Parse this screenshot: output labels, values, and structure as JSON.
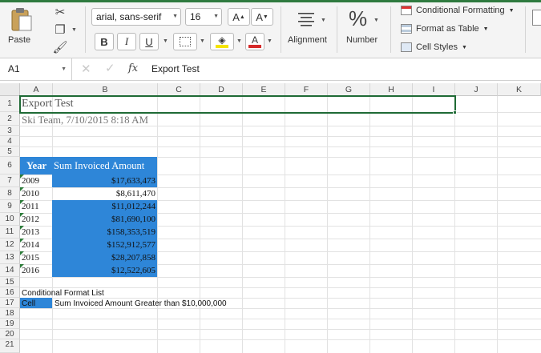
{
  "ribbon": {
    "paste_label": "Paste",
    "font_name": "arial, sans-serif",
    "font_size": "16",
    "increase_font_label": "A",
    "decrease_font_label": "A",
    "bold_label": "B",
    "italic_label": "I",
    "underline_label": "U",
    "font_color_label": "A",
    "alignment_label": "Alignment",
    "number_label": "Number",
    "number_icon": "%",
    "conditional_formatting_label": "Conditional Formatting",
    "format_as_table_label": "Format as Table",
    "cell_styles_label": "Cell Styles",
    "accent_color": "#2f7a3f",
    "fill_color": "#f5e400",
    "font_color": "#d62b2b"
  },
  "formula_bar": {
    "name_box": "A1",
    "fx_label": "fx",
    "content": "Export Test"
  },
  "columns": [
    "A",
    "B",
    "C",
    "D",
    "E",
    "F",
    "G",
    "H",
    "I",
    "J",
    "K"
  ],
  "rows": [
    "1",
    "2",
    "3",
    "4",
    "5",
    "6",
    "7",
    "8",
    "9",
    "10",
    "11",
    "12",
    "13",
    "14",
    "15",
    "16",
    "17",
    "18",
    "19",
    "20",
    "21"
  ],
  "sheet": {
    "title": "Export Test",
    "subtitle": "Ski Team, 7/10/2015 8:18 AM",
    "table_header_year": "Year",
    "table_header_amount": "Sum Invoiced Amount",
    "table_rows": [
      {
        "year": "2009",
        "amount": "$17,633,473"
      },
      {
        "year": "2010",
        "amount": "$8,611,470"
      },
      {
        "year": "2011",
        "amount": "$11,012,244"
      },
      {
        "year": "2012",
        "amount": "$81,690,100"
      },
      {
        "year": "2013",
        "amount": "$158,353,519"
      },
      {
        "year": "2014",
        "amount": "$152,912,577"
      },
      {
        "year": "2015",
        "amount": "$28,207,858"
      },
      {
        "year": "2016",
        "amount": "$12,522,605"
      }
    ],
    "conditional_format_title": "Conditional Format List",
    "cf_cell_label": "Cell",
    "cf_rule": "Sum Invoiced Amount Greater than $10,000,000",
    "highlight_color": "#2e86d8"
  }
}
